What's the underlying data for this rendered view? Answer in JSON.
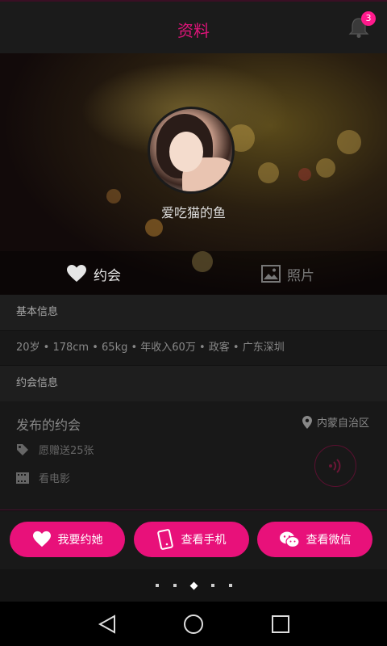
{
  "header": {
    "title": "资料",
    "notification_count": "3"
  },
  "profile": {
    "nickname": "爱吃猫的鱼"
  },
  "tabs": [
    {
      "label": "约会",
      "active": true,
      "icon": "heart-icon"
    },
    {
      "label": "照片",
      "active": false,
      "icon": "image-icon"
    }
  ],
  "basic_info": {
    "heading": "基本信息",
    "summary": "20岁 • 178cm • 65kg • 年收入60万 • 政客 • 广东深圳"
  },
  "date_info": {
    "heading": "约会信息",
    "published_title": "发布的约会",
    "location": "内蒙自治区",
    "gift": "愿赠送25张",
    "activity": "看电影"
  },
  "actions": {
    "date_her": "我要约她",
    "view_phone": "查看手机",
    "view_wechat": "查看微信"
  },
  "pager": {
    "count": 5,
    "active_index": 2
  },
  "colors": {
    "accent": "#e8117a",
    "title": "#e0147a",
    "background": "#111111"
  }
}
